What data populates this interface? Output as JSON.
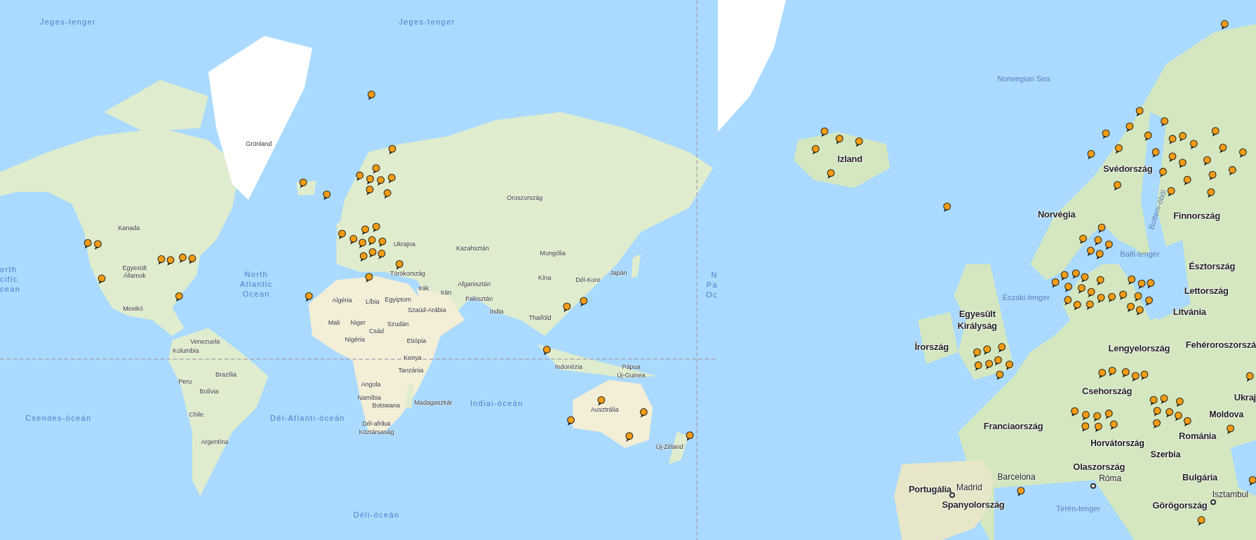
{
  "panels": [
    {
      "kind": "world",
      "labels": [
        {
          "text": "Jeges-tenger",
          "kind": "ocean"
        },
        {
          "text": "Jeges-tenger",
          "kind": "ocean"
        },
        {
          "text": "Grönland",
          "kind": "country"
        },
        {
          "text": "Oroszország",
          "kind": "country"
        },
        {
          "text": "Kanada",
          "kind": "country"
        },
        {
          "text": "Ukrajna",
          "kind": "country"
        },
        {
          "text": "Kazahsztán",
          "kind": "country"
        },
        {
          "text": "Mongólia",
          "kind": "country"
        },
        {
          "text": "orth\ncific\ncean",
          "kind": "ocean"
        },
        {
          "text": "Egyesült\nÁllamok",
          "kind": "country"
        },
        {
          "text": "North\nAtlantic\nOcean",
          "kind": "ocean"
        },
        {
          "text": "Törökország",
          "kind": "country"
        },
        {
          "text": "Irák",
          "kind": "country"
        },
        {
          "text": "Irán",
          "kind": "country"
        },
        {
          "text": "Afganisztán",
          "kind": "country"
        },
        {
          "text": "Kína",
          "kind": "country"
        },
        {
          "text": "Dél-Kore",
          "kind": "country"
        },
        {
          "text": "Japán",
          "kind": "country"
        },
        {
          "text": "N\nPa\nOc",
          "kind": "ocean"
        },
        {
          "text": "Algéria",
          "kind": "country"
        },
        {
          "text": "Líbia",
          "kind": "country"
        },
        {
          "text": "Egyiptom",
          "kind": "country"
        },
        {
          "text": "Pakisztán",
          "kind": "country"
        },
        {
          "text": "Mexikó",
          "kind": "country"
        },
        {
          "text": "Szaúd-Arábia",
          "kind": "country"
        },
        {
          "text": "India",
          "kind": "country"
        },
        {
          "text": "Thaiföld",
          "kind": "country"
        },
        {
          "text": "Mali",
          "kind": "country"
        },
        {
          "text": "Niger",
          "kind": "country"
        },
        {
          "text": "Csád",
          "kind": "country"
        },
        {
          "text": "Szudán",
          "kind": "country"
        },
        {
          "text": "Venezuela",
          "kind": "country"
        },
        {
          "text": "Nigéria",
          "kind": "country"
        },
        {
          "text": "Etiópia",
          "kind": "country"
        },
        {
          "text": "Kolumbia",
          "kind": "country"
        },
        {
          "text": "Kenya",
          "kind": "country"
        },
        {
          "text": "Brazília",
          "kind": "country"
        },
        {
          "text": "Tanzánia",
          "kind": "country"
        },
        {
          "text": "Indonézia",
          "kind": "country"
        },
        {
          "text": "Pápua\nÚj-Guinea",
          "kind": "country"
        },
        {
          "text": "Peru",
          "kind": "country"
        },
        {
          "text": "Angola",
          "kind": "country"
        },
        {
          "text": "Bolívia",
          "kind": "country"
        },
        {
          "text": "Namíbia",
          "kind": "country"
        },
        {
          "text": "Botswana",
          "kind": "country"
        },
        {
          "text": "Madagaszkár",
          "kind": "country"
        },
        {
          "text": "Indiai-óceán",
          "kind": "ocean"
        },
        {
          "text": "Ausztrália",
          "kind": "country"
        },
        {
          "text": "Csendes-óceán",
          "kind": "ocean"
        },
        {
          "text": "Chile",
          "kind": "country"
        },
        {
          "text": "Dél-Atlanti-óceán",
          "kind": "ocean"
        },
        {
          "text": "Dél-afrikai\nKöztársaság",
          "kind": "country"
        },
        {
          "text": "Argentína",
          "kind": "country"
        },
        {
          "text": "Új-Zéland",
          "kind": "country"
        },
        {
          "text": "Déli-óceán",
          "kind": "ocean"
        }
      ]
    },
    {
      "kind": "europe",
      "labels": [
        {
          "text": "Norwegian Sea",
          "kind": "sea"
        },
        {
          "text": "Izland",
          "kind": "country"
        },
        {
          "text": "Svédország",
          "kind": "country"
        },
        {
          "text": "Norvégia",
          "kind": "country"
        },
        {
          "text": "Botteni-öböl",
          "kind": "sea"
        },
        {
          "text": "Finnország",
          "kind": "country"
        },
        {
          "text": "Balti-tenger",
          "kind": "sea"
        },
        {
          "text": "Észtország",
          "kind": "country"
        },
        {
          "text": "Északi-tenger",
          "kind": "sea"
        },
        {
          "text": "Lettország",
          "kind": "country"
        },
        {
          "text": "Egyesült\nKirályság",
          "kind": "country"
        },
        {
          "text": "Litvánia",
          "kind": "country"
        },
        {
          "text": "Írország",
          "kind": "country"
        },
        {
          "text": "Lengyelország",
          "kind": "country"
        },
        {
          "text": "Fehéroroszorszá",
          "kind": "country"
        },
        {
          "text": "Csehország",
          "kind": "country"
        },
        {
          "text": "Ukraj",
          "kind": "country"
        },
        {
          "text": "Moldova",
          "kind": "minor"
        },
        {
          "text": "Franciaország",
          "kind": "country"
        },
        {
          "text": "Horvátország",
          "kind": "minor"
        },
        {
          "text": "Románia",
          "kind": "country"
        },
        {
          "text": "Szerbia",
          "kind": "minor"
        },
        {
          "text": "Olaszország",
          "kind": "country"
        },
        {
          "text": "Barcelona",
          "kind": "place"
        },
        {
          "text": "Róma",
          "kind": "city"
        },
        {
          "text": "Bulgária",
          "kind": "country"
        },
        {
          "text": "Portugália",
          "kind": "country"
        },
        {
          "text": "Madrid",
          "kind": "city"
        },
        {
          "text": "Tirrén-tenger",
          "kind": "sea"
        },
        {
          "text": "Isztambul",
          "kind": "city"
        },
        {
          "text": "Spanyolország",
          "kind": "country"
        },
        {
          "text": "Görögország",
          "kind": "country"
        }
      ]
    }
  ]
}
